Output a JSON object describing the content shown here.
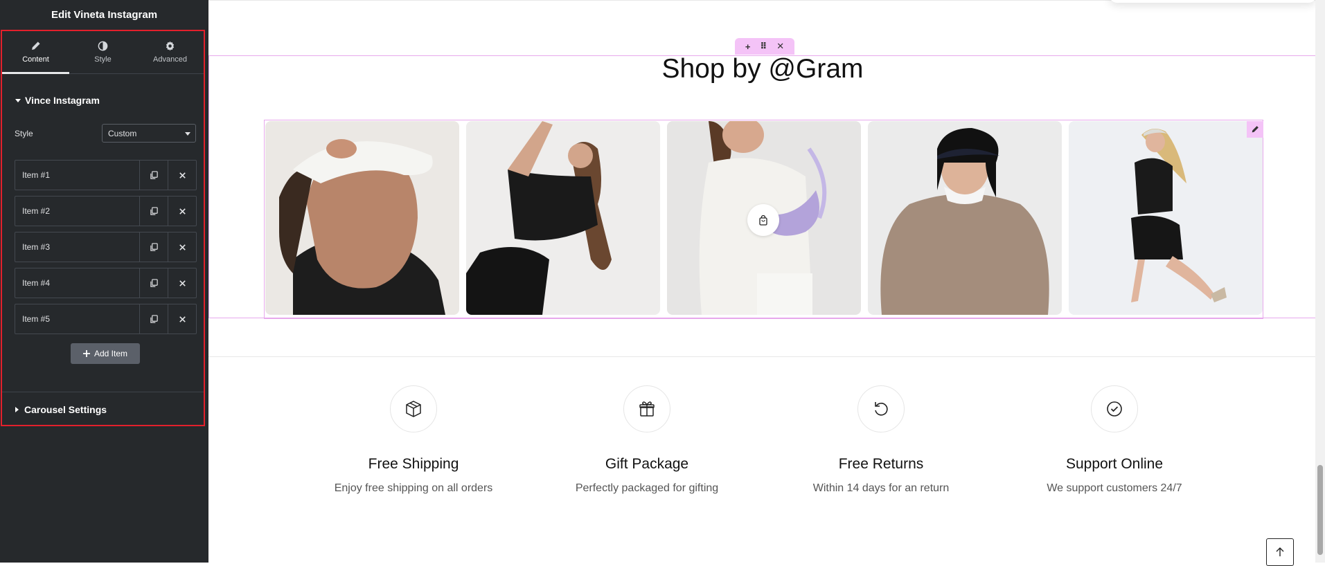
{
  "panel": {
    "title": "Edit Vineta Instagram",
    "tabs": [
      {
        "label": "Content",
        "icon": "pencil-icon",
        "active": true
      },
      {
        "label": "Style",
        "icon": "contrast-icon",
        "active": false
      },
      {
        "label": "Advanced",
        "icon": "gear-icon",
        "active": false
      }
    ],
    "section_title": "Vince Instagram",
    "style_label": "Style",
    "style_value": "Custom",
    "items": [
      "Item #1",
      "Item #2",
      "Item #3",
      "Item #4",
      "Item #5"
    ],
    "add_item_label": "Add Item",
    "carousel_title": "Carousel Settings",
    "accent_color": "#e3202c"
  },
  "canvas": {
    "title": "Shop by @Gram",
    "handle_icons": [
      "plus-icon",
      "drag-icon",
      "close-icon"
    ],
    "photos": [
      {
        "name": "woman-white-visor",
        "icon": "instagram-photo"
      },
      {
        "name": "woman-black-crop-top-stretch",
        "icon": "instagram-photo"
      },
      {
        "name": "woman-lilac-shoulder-bag",
        "icon": "instagram-photo"
      },
      {
        "name": "woman-beige-sweatshirt-cap",
        "icon": "instagram-photo"
      },
      {
        "name": "woman-running-black-outfit",
        "icon": "instagram-photo"
      }
    ],
    "features": [
      {
        "title": "Free Shipping",
        "desc": "Enjoy free shipping on all orders",
        "icon": "box-icon"
      },
      {
        "title": "Gift Package",
        "desc": "Perfectly packaged for gifting",
        "icon": "gift-icon"
      },
      {
        "title": "Free Returns",
        "desc": "Within 14 days for an return",
        "icon": "return-icon"
      },
      {
        "title": "Support Online",
        "desc": "We support customers 24/7",
        "icon": "check-badge-icon"
      }
    ],
    "outline_color": "#e7a8ec"
  }
}
